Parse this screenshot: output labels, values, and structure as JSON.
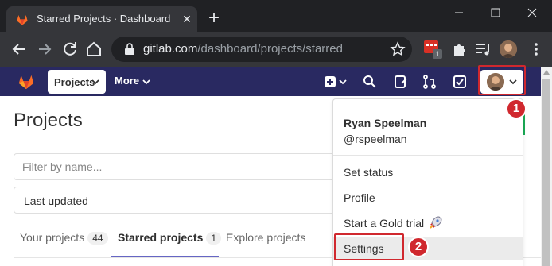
{
  "browser": {
    "tab_title": "Starred Projects · Dashboard · GitLab",
    "url_host": "gitlab.com",
    "url_path": "/dashboard/projects/starred",
    "extension_badge": "1"
  },
  "gitlab_nav": {
    "projects_label": "Projects",
    "more_label": "More"
  },
  "page": {
    "title": "Projects",
    "filter_placeholder": "Filter by name...",
    "sort_value": "Last updated",
    "tabs": [
      {
        "label": "Your projects",
        "count": "44"
      },
      {
        "label": "Starred projects",
        "count": "1"
      },
      {
        "label": "Explore projects",
        "count": ""
      }
    ]
  },
  "user_menu": {
    "name": "Ryan Speelman",
    "handle": "@rspeelman",
    "items": [
      {
        "label": "Set status"
      },
      {
        "label": "Profile"
      },
      {
        "label": "Start a Gold trial"
      },
      {
        "label": "Settings"
      }
    ]
  },
  "callouts": [
    "1",
    "2"
  ],
  "colors": {
    "gitlab_nav": "#292961",
    "callout": "#d0282e",
    "tab_underline": "#6666c4",
    "chrome_dark": "#202124"
  }
}
